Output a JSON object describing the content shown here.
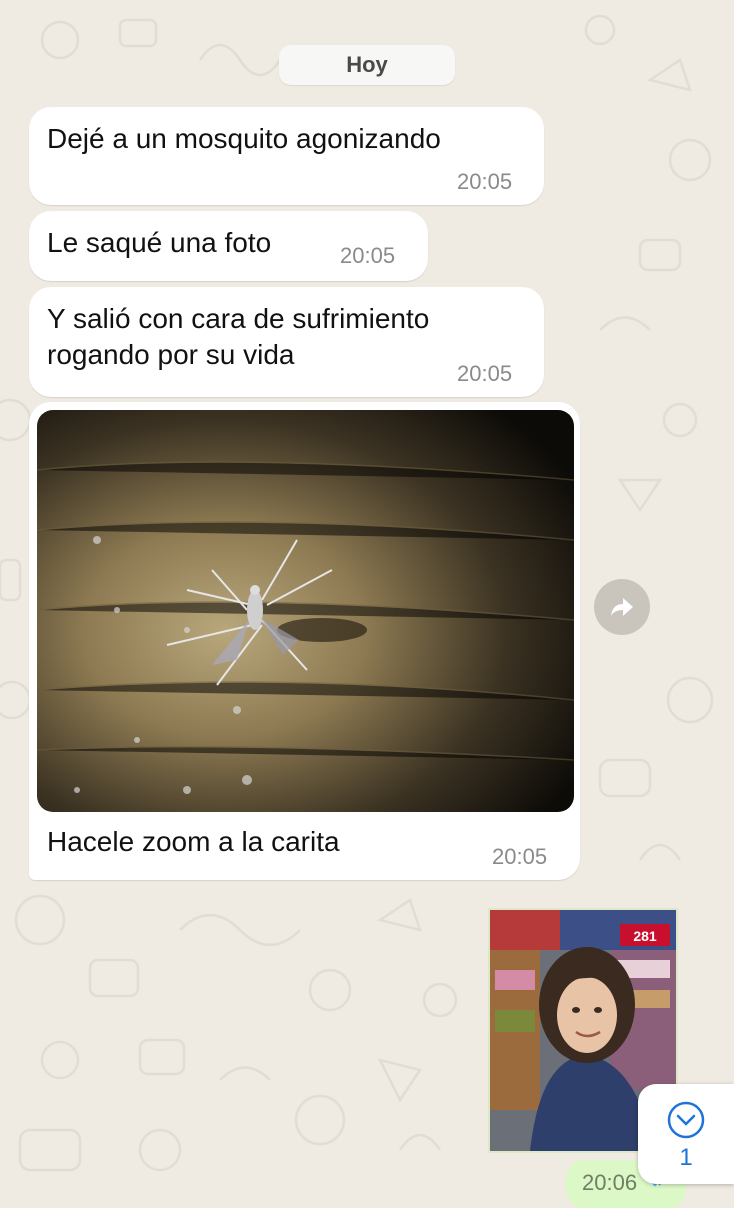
{
  "chat": {
    "date_label": "Hoy",
    "messages": [
      {
        "text": "Dejé a un mosquito agonizando",
        "time": "20:05"
      },
      {
        "text": "Le saqué una foto",
        "time": "20:05"
      },
      {
        "text": "Y salió con cara de sufrimiento\nrogando por su vida",
        "time": "20:05"
      },
      {
        "caption": "Hacele zoom a la carita",
        "time": "20:05",
        "media": "photo of a dying mosquito on a wooden surface"
      }
    ],
    "outgoing": {
      "time": "20:06",
      "media": "photo of a smiling woman in a store",
      "sign_text": "281"
    }
  },
  "scroll_button": {
    "icon": "chevron-down-icon",
    "unread_count": "1"
  },
  "icons": {
    "forward": "forward-icon",
    "read_receipt": "double-check-icon"
  },
  "colors": {
    "wallpaper": "#efeae2",
    "incoming_bubble": "#ffffff",
    "outgoing_bubble": "#dcf8c6",
    "accent": "#1e74d8",
    "timestamp": "#8a8a8a"
  }
}
